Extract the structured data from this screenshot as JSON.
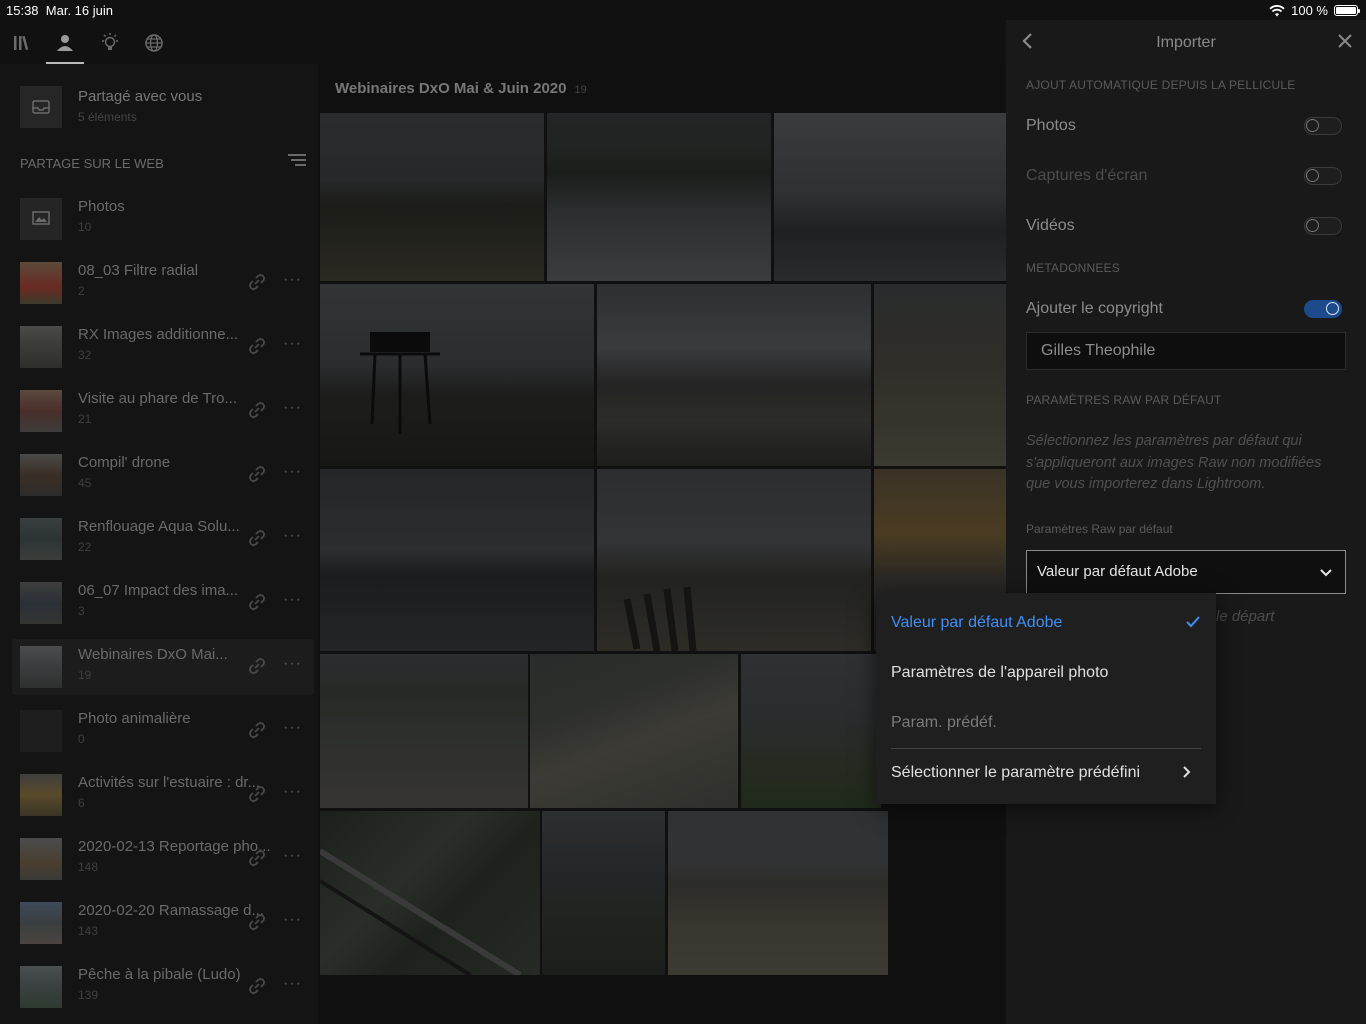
{
  "status": {
    "time": "15:38",
    "date": "Mar. 16 juin",
    "battery": "100 %"
  },
  "shared": {
    "title": "Partagé avec vous",
    "subtitle": "5 éléments"
  },
  "sidebar": {
    "section_title": "PARTAGE SUR LE WEB",
    "albums": [
      {
        "name": "Photos",
        "count": "10"
      },
      {
        "name": "08_03 Filtre radial",
        "count": "2"
      },
      {
        "name": "RX Images additionne...",
        "count": "32"
      },
      {
        "name": "Visite au phare de Tro...",
        "count": "21"
      },
      {
        "name": "Compil' drone",
        "count": "45"
      },
      {
        "name": "Renflouage Aqua Solu...",
        "count": "22"
      },
      {
        "name": "06_07 Impact des ima...",
        "count": "3"
      },
      {
        "name": "Webinaires DxO Mai...",
        "count": "19"
      },
      {
        "name": "Photo animalière",
        "count": "0"
      },
      {
        "name": "Activités sur l'estuaire : dr...",
        "count": "6"
      },
      {
        "name": "2020-02-13 Reportage pho...",
        "count": "148"
      },
      {
        "name": "2020-02-20 Ramassage d...",
        "count": "143"
      },
      {
        "name": "Pêche à la pibale (Ludo)",
        "count": "139"
      }
    ]
  },
  "main": {
    "album_title": "Webinaires DxO Mai & Juin 2020",
    "count": "19"
  },
  "panel": {
    "title": "Importer",
    "auto_add_header": "AJOUT AUTOMATIQUE DEPUIS LA PELLICULE",
    "photos_label": "Photos",
    "screenshots_label": "Captures d'écran",
    "videos_label": "Vidéos",
    "metadata_header": "METADONNEES",
    "copyright_label": "Ajouter le copyright",
    "copyright_value": "Gilles Theophile",
    "raw_header": "PARAMÈTRES RAW PAR DÉFAUT",
    "raw_description": "Sélectionnez les paramètres par défaut qui s'appliqueront aux images Raw non modifiées que vous importerez dans Lightroom.",
    "raw_small_label": "Paramètres Raw par défaut",
    "raw_select_value": "Valeur par défaut Adobe",
    "hint_partial": "le départ",
    "toggles": {
      "photos": false,
      "screenshots": false,
      "videos": false,
      "copyright": true
    }
  },
  "popover": {
    "options": [
      "Valeur par défaut Adobe",
      "Paramètres de l'appareil photo",
      "Param. prédéf.",
      "Sélectionner le paramètre prédéfini"
    ],
    "selected_index": 0
  },
  "colors": {
    "accent": "#3f8ef5",
    "toggle_on": "#1c4a8a"
  }
}
